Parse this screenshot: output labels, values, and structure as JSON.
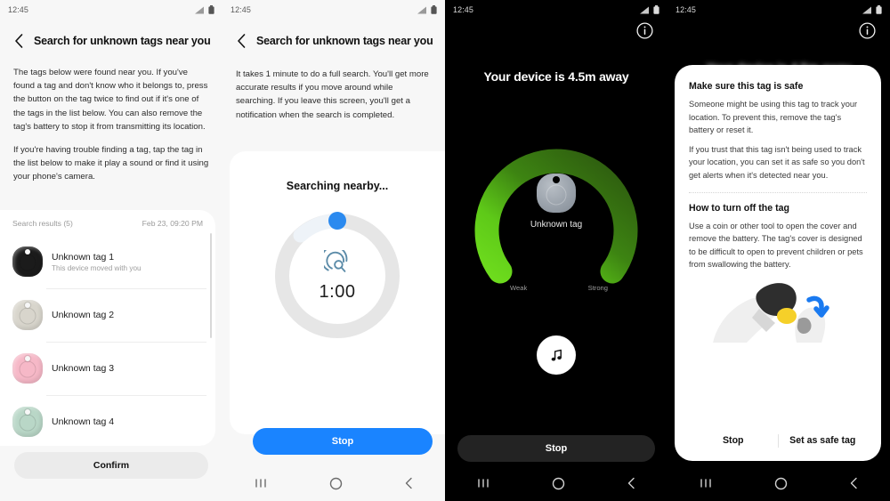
{
  "statusbar": {
    "time": "12:45"
  },
  "panel1": {
    "title": "Search for unknown tags near you",
    "back_icon": "chevron-left-icon",
    "paragraphs": [
      "The tags below were found near you. If you've found a tag and don't know who it belongs to, press the button on the tag twice to find out if it's one of the tags in the list below. You can also remove the tag's battery to stop it from transmitting its location.",
      "If you're having trouble finding a tag, tap the tag in the list below to make it play a sound or find it using your phone's camera."
    ],
    "list_header": {
      "label": "Search results (5)",
      "timestamp": "Feb 23, 09:20 PM"
    },
    "tags": [
      {
        "name": "Unknown tag 1",
        "subtitle": "This device moved with you",
        "color": "#1b1b1b"
      },
      {
        "name": "Unknown tag 2",
        "subtitle": "",
        "color": "#d8d5cc"
      },
      {
        "name": "Unknown tag 3",
        "subtitle": "",
        "color": "#f6b8c7"
      },
      {
        "name": "Unknown tag 4",
        "subtitle": "",
        "color": "#b9d7c7"
      }
    ],
    "confirm_label": "Confirm"
  },
  "panel2": {
    "title": "Search for unknown tags near you",
    "paragraphs": [
      "It takes 1 minute to do a full search. You'll get more accurate results if you move around while searching. If you leave this screen, you'll get a notification when the search is completed."
    ],
    "searching_label": "Searching nearby...",
    "timer": "1:00",
    "radar_icon": "radar-scan-icon",
    "stop_label": "Stop",
    "accent": "#1a84ff"
  },
  "panel3": {
    "info_icon": "info-circle-icon",
    "distance_title": "Your device is 4.5m away",
    "tag_label": "Unknown tag",
    "gauge": {
      "weak_label": "Weak",
      "strong_label": "Strong",
      "bright": "#5ec918",
      "dark": "#2f5c10"
    },
    "sound_icon": "music-note-icon",
    "stop_label": "Stop"
  },
  "panel4": {
    "info_icon": "info-circle-icon",
    "background_title": "Your device is 4.5m away",
    "dialog": {
      "heading_1": "Make sure this tag is safe",
      "body_1": "Someone might be using this tag to track your location. To prevent this, remove the tag's battery or reset it.",
      "body_2": "If you trust that this tag isn't being used to track your location, you can set it as safe so you don't get alerts when it's detected near you.",
      "heading_2": "How to turn off the tag",
      "body_3": "Use a coin or other tool to open the cover and remove the battery. The tag's cover is designed to be difficult to open to prevent children or pets from swallowing the battery.",
      "illustration": "hands-opening-tag-with-coin-illustration",
      "left_button": "Stop",
      "right_button": "Set as safe tag"
    }
  },
  "navbar": {
    "recents_icon": "recents-icon",
    "home_icon": "home-icon",
    "back_icon": "back-icon"
  }
}
